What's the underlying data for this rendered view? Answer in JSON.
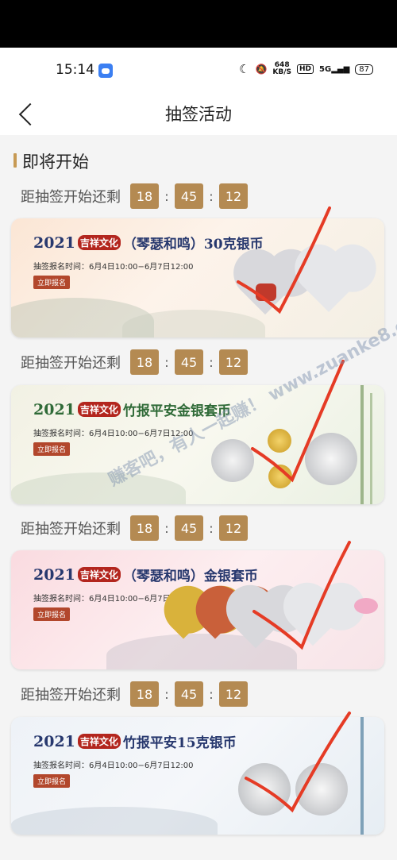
{
  "status_bar": {
    "time": "15:14",
    "net_speed_value": "648",
    "net_speed_unit": "KB/S",
    "hd": "HD",
    "signal": "5G",
    "battery": "87"
  },
  "nav": {
    "title": "抽签活动"
  },
  "section": {
    "title": "即将开始"
  },
  "countdowns": [
    {
      "label": "距抽签开始还剩",
      "h": "18",
      "m": "45",
      "s": "12"
    },
    {
      "label": "距抽签开始还剩",
      "h": "18",
      "m": "45",
      "s": "12"
    },
    {
      "label": "距抽签开始还剩",
      "h": "18",
      "m": "45",
      "s": "12"
    },
    {
      "label": "距抽签开始还剩",
      "h": "18",
      "m": "45",
      "s": "12"
    }
  ],
  "banners": [
    {
      "year": "2021",
      "tag": "吉祥文化",
      "name": "（琴瑟和鸣）30克银币",
      "time": "抽签报名时间：6月4日10:00−6月7日12:00",
      "button": "立即报名"
    },
    {
      "year": "2021",
      "tag": "吉祥文化",
      "name": "竹报平安金银套币",
      "time": "抽签报名时间：6月4日10:00−6月7日12:00",
      "button": "立即报名"
    },
    {
      "year": "2021",
      "tag": "吉祥文化",
      "name": "（琴瑟和鸣）金银套币",
      "time": "抽签报名时间：6月4日10:00−6月7日12:00",
      "button": "立即报名"
    },
    {
      "year": "2021",
      "tag": "吉祥文化",
      "name": "竹报平安15克银币",
      "time": "抽签报名时间：6月4日10:00−6月7日12:00",
      "button": "立即报名"
    }
  ],
  "watermark": "赚客吧，有人一起赚！ www.zuanke8.com",
  "colors": {
    "accent": "#b48a52",
    "check": "#e53b25",
    "button": "#b2472c"
  }
}
